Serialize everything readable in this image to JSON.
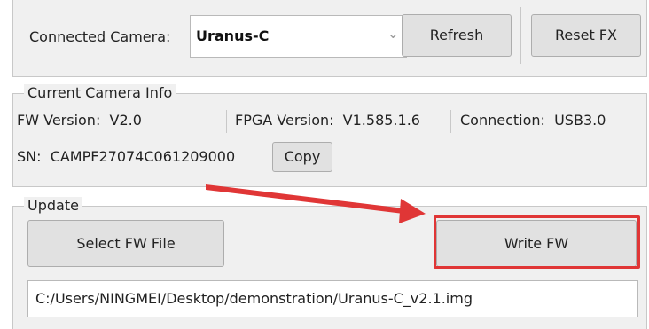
{
  "camera_bar": {
    "label": "Connected Camera:",
    "selected_camera": "Uranus-C",
    "refresh_label": "Refresh",
    "reset_fx_label": "Reset FX"
  },
  "camera_info": {
    "title": "Current Camera Info",
    "fw_version": "FW Version:  V2.0",
    "fpga_version": "FPGA Version:  V1.585.1.6",
    "connection": "Connection:  USB3.0",
    "sn": "SN:  CAMPF27074C061209000",
    "copy_label": "Copy"
  },
  "update": {
    "title": "Update",
    "select_fw_label": "Select FW File",
    "write_fw_label": "Write FW",
    "file_path": "C:/Users/NINGMEI/Desktop/demonstration/Uranus-C_v2.1.img"
  },
  "annotation": {
    "color": "#e03636"
  }
}
